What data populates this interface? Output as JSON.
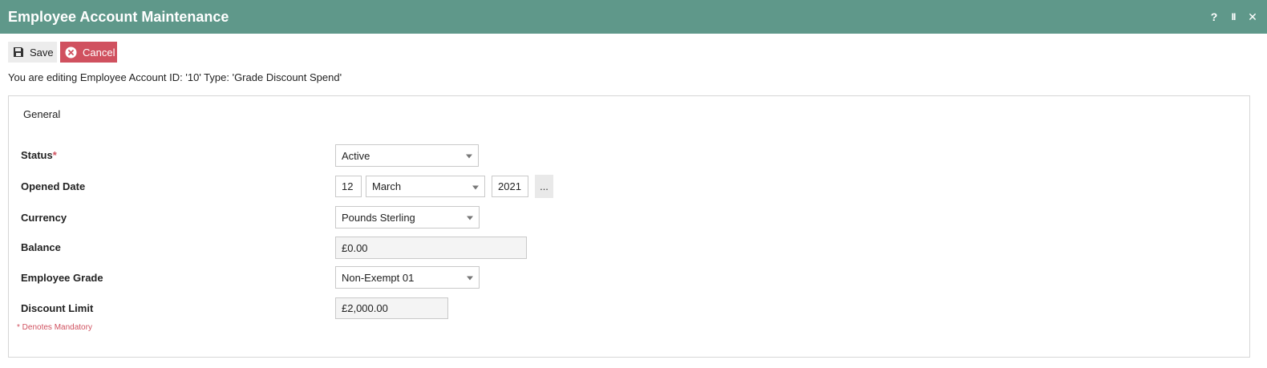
{
  "window": {
    "title": "Employee Account Maintenance",
    "controls": [
      {
        "icon": "help-icon",
        "glyph": "?"
      },
      {
        "icon": "pause-icon",
        "glyph": "II"
      },
      {
        "icon": "close-icon",
        "glyph": "✕"
      }
    ]
  },
  "toolbar": {
    "save_label": "Save",
    "cancel_label": "Cancel"
  },
  "info_text": "You are editing Employee Account ID: '10' Type: 'Grade Discount Spend'",
  "panel": {
    "section_title": "General",
    "status": {
      "label": "Status",
      "required_mark": "*",
      "value": "Active"
    },
    "opened_date": {
      "label": "Opened Date",
      "day": "12",
      "month": "March",
      "year": "2021",
      "picker_label": "..."
    },
    "currency": {
      "label": "Currency",
      "value": "Pounds Sterling"
    },
    "balance": {
      "label": "Balance",
      "value": "£0.00"
    },
    "employee_grade": {
      "label": "Employee Grade",
      "value": "Non-Exempt 01"
    },
    "discount_limit": {
      "label": "Discount Limit",
      "value": "£2,000.00"
    },
    "mandatory_note": "* Denotes Mandatory"
  },
  "colors": {
    "titlebar": "#5f988a",
    "cancel": "#d0515f",
    "required": "#d0515f"
  }
}
